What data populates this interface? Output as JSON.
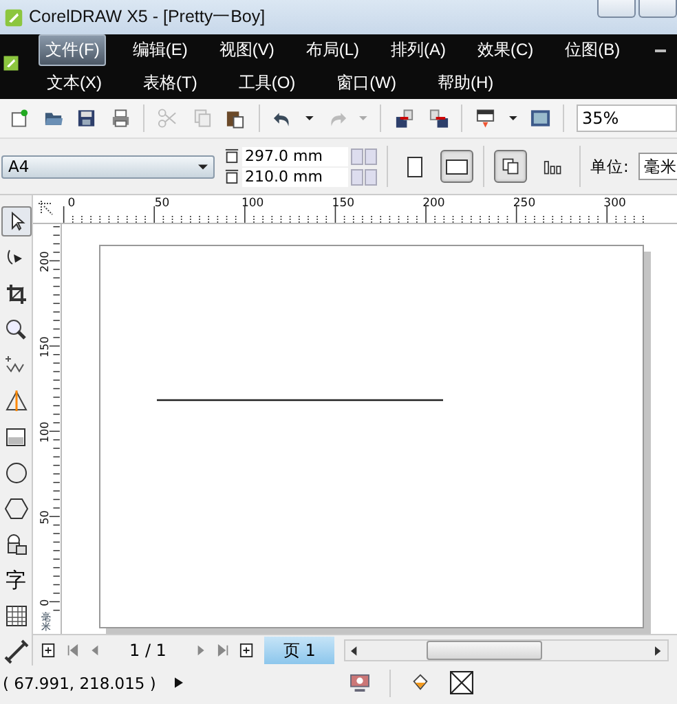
{
  "window": {
    "title": "CorelDRAW X5 - [Pretty一Boy]"
  },
  "menu_rows": [
    [
      {
        "label": "文件(F)",
        "selected": true
      },
      {
        "label": "编辑(E)",
        "selected": false
      },
      {
        "label": "视图(V)",
        "selected": false
      },
      {
        "label": "布局(L)",
        "selected": false
      },
      {
        "label": "排列(A)",
        "selected": false
      },
      {
        "label": "效果(C)",
        "selected": false
      },
      {
        "label": "位图(B)",
        "selected": false
      }
    ],
    [
      {
        "label": "文本(X)",
        "selected": false
      },
      {
        "label": "表格(T)",
        "selected": false
      },
      {
        "label": "工具(O)",
        "selected": false
      },
      {
        "label": "窗口(W)",
        "selected": false
      },
      {
        "label": "帮助(H)",
        "selected": false
      }
    ]
  ],
  "zoom": {
    "value": "35%"
  },
  "page_size": {
    "value": "A4"
  },
  "page_width": {
    "value": "297.0 mm"
  },
  "page_height": {
    "value": "210.0 mm"
  },
  "orientation": [
    {
      "kind": "portrait",
      "selected": false
    },
    {
      "kind": "landscape",
      "selected": true
    }
  ],
  "layout_buttons": [
    {
      "kind": "all-pages",
      "selected": true
    },
    {
      "kind": "current-page",
      "selected": false
    }
  ],
  "units": {
    "label": "单位:",
    "value": "毫米"
  },
  "ruler": {
    "x_labels": [
      "0",
      "50",
      "100",
      "150",
      "200",
      "250",
      "300"
    ],
    "y_labels": [
      "200",
      "150",
      "100",
      "50",
      "0"
    ],
    "unit": "毫米"
  },
  "text_tool": "字",
  "pager": {
    "count": "1 / 1",
    "tabs": [
      {
        "label": "页 1",
        "selected": true
      }
    ]
  },
  "status": {
    "coordinates": "( 67.991, 218.015 )"
  }
}
